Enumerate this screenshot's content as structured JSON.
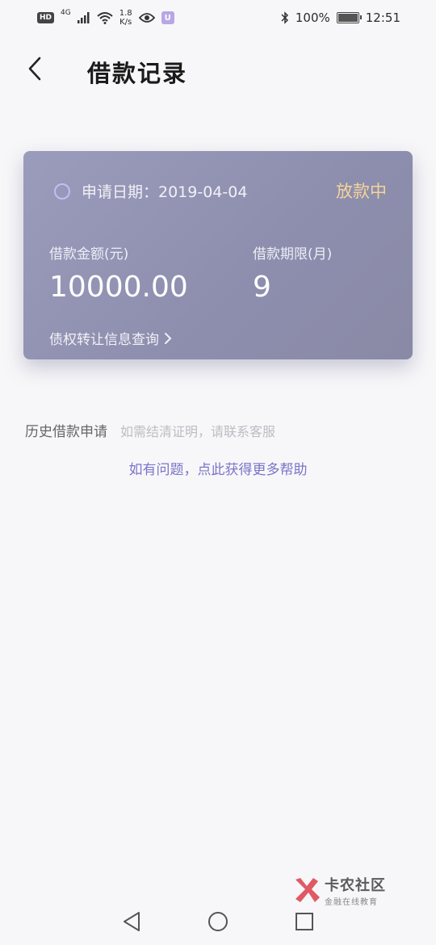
{
  "status_bar": {
    "hd": "HD",
    "network": "4G",
    "speed_value": "1.8",
    "speed_unit": "K/s",
    "u_badge": "U",
    "battery_pct": "100%",
    "time": "12:51"
  },
  "header": {
    "title": "借款记录"
  },
  "card": {
    "date_label": "申请日期：2019-04-04",
    "status": "放款中",
    "amount_label": "借款金额(元)",
    "amount_value": "10000.00",
    "term_label": "借款期限(月)",
    "term_value": "9",
    "transfer_link": "债权转让信息查询"
  },
  "history": {
    "title": "历史借款申请",
    "hint": "如需结清证明，请联系客服"
  },
  "help_link": "如有问题，点此获得更多帮助",
  "watermark": {
    "title": "卡农社区",
    "subtitle": "金融在线教育"
  },
  "colors": {
    "status_orange": "#f5d39a",
    "link_purple": "#7a74c8",
    "card_bg": "#9b9cbc"
  }
}
